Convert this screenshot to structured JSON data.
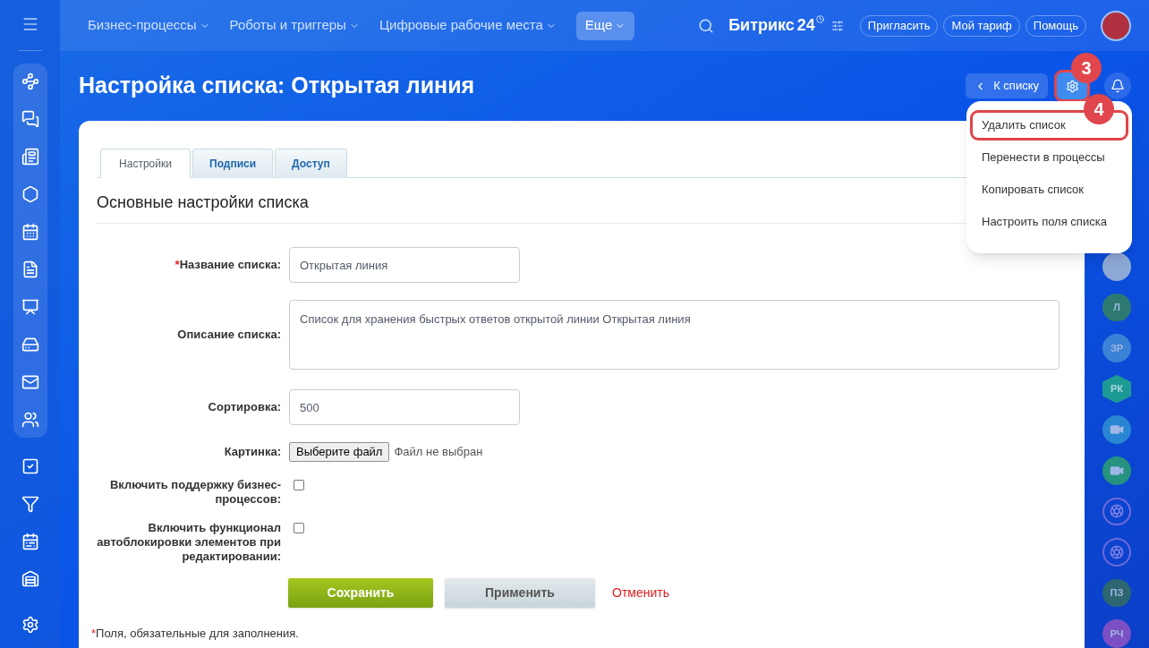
{
  "top_nav": [
    {
      "label": "Бизнес-процессы",
      "selected": false
    },
    {
      "label": "Роботы и триггеры",
      "selected": false
    },
    {
      "label": "Цифровые рабочие места",
      "selected": false
    },
    {
      "label": "Еще",
      "selected": true
    }
  ],
  "logo": {
    "name": "Битрикс",
    "number": "24"
  },
  "header_buttons": [
    "Пригласить",
    "Мой тариф",
    "Помощь"
  ],
  "page_title": "Настройка списка: Открытая линия",
  "back_button": "К списку",
  "annotations": [
    {
      "label": "3"
    },
    {
      "label": "4"
    }
  ],
  "settings_menu": [
    {
      "label": "Удалить список",
      "annotated": true
    },
    {
      "label": "Перенести в процессы",
      "annotated": false
    },
    {
      "label": "Копировать список",
      "annotated": false
    },
    {
      "label": "Настроить поля списка",
      "annotated": false
    }
  ],
  "tabs": [
    {
      "label": "Настройки",
      "selected": true
    },
    {
      "label": "Подписи",
      "selected": false
    },
    {
      "label": "Доступ",
      "selected": false
    }
  ],
  "section_title": "Основные настройки списка",
  "fields": [
    {
      "kind": "text",
      "required_mark": "*",
      "label": "Название списка:",
      "value": "Открытая линия"
    },
    {
      "kind": "textarea",
      "label": "Описание списка:",
      "value": "Список для хранения быстрых ответов открытой линии Открытая линия"
    },
    {
      "kind": "text",
      "label": "Сортировка:",
      "value": "500"
    },
    {
      "kind": "file",
      "label": "Картинка:",
      "button": "Выберите файл",
      "status": "Файл не выбран"
    },
    {
      "kind": "checkbox",
      "label": "Включить поддержку бизнес-процессов:",
      "checked": false
    },
    {
      "kind": "checkbox",
      "label": "Включить функционал автоблокировки элементов при редактировании:",
      "checked": false
    }
  ],
  "actions": {
    "save": "Сохранить",
    "apply": "Применить",
    "cancel": "Отменить"
  },
  "footnote": {
    "mark": "*",
    "text": "Поля, обязательные для заполнения."
  },
  "right_rail": [
    {
      "kind": "photo",
      "color": "#8fa9d6"
    },
    {
      "kind": "initials",
      "text": "Л",
      "color": "#2e7a72"
    },
    {
      "kind": "initials",
      "text": "ЗР",
      "color": "#3a82d6"
    },
    {
      "kind": "hex",
      "text": "РК",
      "color": "#1d9a94"
    },
    {
      "kind": "video",
      "color": "#2a86d2"
    },
    {
      "kind": "video",
      "color": "#26927f"
    },
    {
      "kind": "channel",
      "color": "#6f6ad8"
    },
    {
      "kind": "channel",
      "color": "#6f6ad8"
    },
    {
      "kind": "initials",
      "text": "ПЗ",
      "color": "#2d6670"
    },
    {
      "kind": "initials",
      "text": "РЧ",
      "color": "#7d4fc4"
    }
  ]
}
